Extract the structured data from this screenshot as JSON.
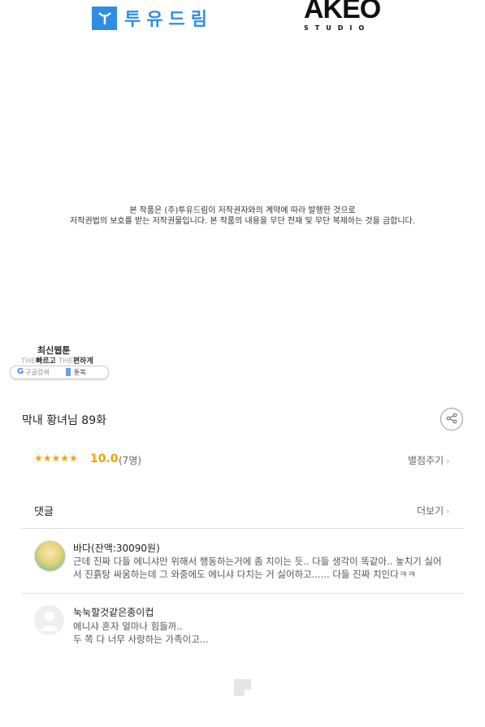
{
  "logos": {
    "todream_icon": "T-icon",
    "todream_name": "투유드림",
    "akeo_name": "AKEO",
    "akeo_studio": "STUDIO"
  },
  "notice": {
    "line1": "본 작품은 (주)투유드림이 저작권자와의 계약에 따라 발행한 것으로",
    "line2": "저작권법의 보호를 받는 저작권물입니다. 본 작품의 내용을 무단 전재 및 무단 복제하는 것을 금합니다."
  },
  "ad": {
    "title": "최신웹툰",
    "the1": "THE",
    "fast": "빠르고",
    "the2": "THE",
    "easy": "편하게",
    "google_search": "구글검색",
    "bookmark": "툰북"
  },
  "episode": {
    "title": "막내 황녀님 89화",
    "share_icon": "share-icon"
  },
  "rating": {
    "stars": "★★★★★",
    "score": "10.0",
    "count": "(7명)",
    "rate_button": "별점주기"
  },
  "comments": {
    "header": "댓글",
    "more": "더보기",
    "items": [
      {
        "name": "바다(잔액:30090원)",
        "line1": "근데 진짜 다들 에니샤만 위해서 행동하는거에 좀 치이는 듯.. 다들 생각이 똑같아.. 놓치기 싫어",
        "line2": "서 진흙탕 싸움하는데 그 와중에도 에니샤 다치는 거 싫어하고...... 다들 진짜 치인다ㅋㅋ"
      },
      {
        "name": "눅눅할것같은종이컵",
        "line1": "에니샤 혼자 얼마나 힘들까..",
        "line2": "두 쪽 다 너무 사랑하는 가족이고..."
      }
    ]
  },
  "colors": {
    "accent_blue": "#2f8de4",
    "star": "#f0a500"
  }
}
